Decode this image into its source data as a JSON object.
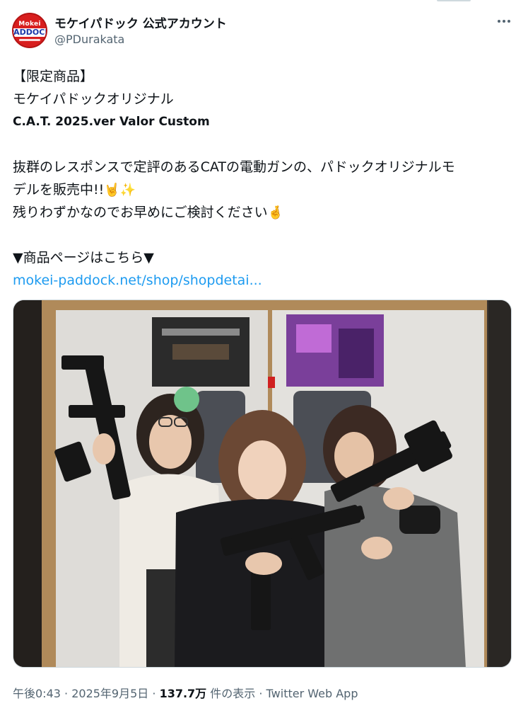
{
  "author": {
    "display_name": "モケイパドック 公式アカウント",
    "handle": "@PDurakata",
    "avatar_text_top": "Mokei",
    "avatar_text_main": "PADDOCK"
  },
  "tweet": {
    "line1": "【限定商品】",
    "line2": "モケイパドックオリジナル",
    "line3": "C.A.T. 2025.ver Valor Custom",
    "line4": "抜群のレスポンスで定評のあるCATの電動ガンの、パドックオリジナルモ",
    "line5": "デルを販売中!!",
    "line5_emoji": "🤘✨",
    "line6": "残りわずかなのでお早めにご検討ください",
    "line6_emoji": "🤞",
    "line7": "▼商品ページはこちら▼",
    "link": "mokei-paddock.net/shop/shopdetai..."
  },
  "meta": {
    "time": "午後0:43",
    "sep1": " · ",
    "date": "2025年9月5日",
    "sep2": " · ",
    "views_count": "137.7万",
    "views_label": " 件の表示",
    "sep3": " · ",
    "source": "Twitter Web App"
  },
  "icons": {
    "more": "more-dots-icon"
  },
  "colors": {
    "link": "#1d9bf0",
    "secondary_text": "#536471",
    "primary_text": "#0f1419",
    "avatar_bg": "#d81e1e"
  }
}
